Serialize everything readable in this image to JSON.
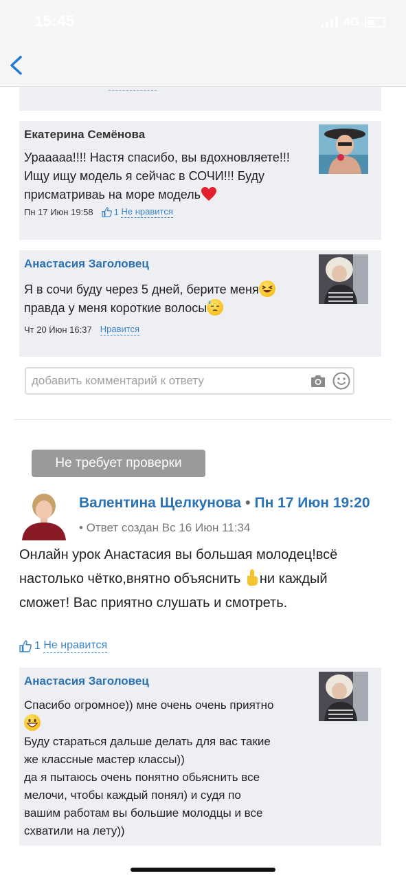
{
  "status_bar": {
    "time": "15:45",
    "network": "4G"
  },
  "nav": {
    "back_icon": "chevron-left-icon"
  },
  "comments": [
    {
      "author": "Екатерина Семёнова",
      "text_lines": [
        "Урааааа!!!! Настя спасибо, вы вдохновляете!!!",
        "Ищу ищу модель я сейчас в СОЧИ!!! Буду",
        "присматриваь на море модель"
      ],
      "trailing_emoji": "red-heart",
      "date": "Пн 17 Июн 19:58",
      "likes": "1",
      "like_action": "Не нравится"
    },
    {
      "author": "Анастасия Заголовец",
      "text_lines": [
        "Я в сочи буду через 5 дней, берите меня",
        " правда у меня короткие волосы"
      ],
      "emojis": [
        "grinning-squinting-face",
        "downcast-face-with-sweat"
      ],
      "date": "Чт 20 Июн 16:37",
      "like_action": "Нравится"
    }
  ],
  "reply_input": {
    "placeholder": "добавить комментарий к ответу",
    "camera_icon": "camera-icon",
    "emoji_icon": "smile-icon"
  },
  "badge": "Не требует проверки",
  "post": {
    "author": "Валентина Щелкунова",
    "separator": "•",
    "date": "Пн 17 Июн 19:20",
    "created": "• Ответ создан Вс 16 Июн 11:34",
    "text_lines": [
      "Онлайн урок Анастасия вы большая молодец!всё",
      "настолько чётко,внятно объяснить",
      "ни каждый",
      "сможет! Вас приятно слушать и смотреть."
    ],
    "inline_emoji": "index-pointing-up",
    "likes": "1",
    "like_action": "Не нравится"
  },
  "reply": {
    "author": "Анастасия Заголовец",
    "text_lines": [
      "Спасибо огромное)) мне очень очень приятно",
      "Буду стараться дальше делать для вас такие",
      "же классные мастер классы))",
      "да я пытаюсь очень понятно обьяснить все",
      "мелочи, чтобы каждый понял) и судя по",
      "вашим работам вы большие молодцы и все",
      "схватили на лету))"
    ],
    "emoji": "grinning-face-with-big-eyes"
  },
  "colors": {
    "link_blue": "#2a72b5",
    "card_bg": "#eeeff3",
    "badge_bg": "#9a9a9a"
  }
}
